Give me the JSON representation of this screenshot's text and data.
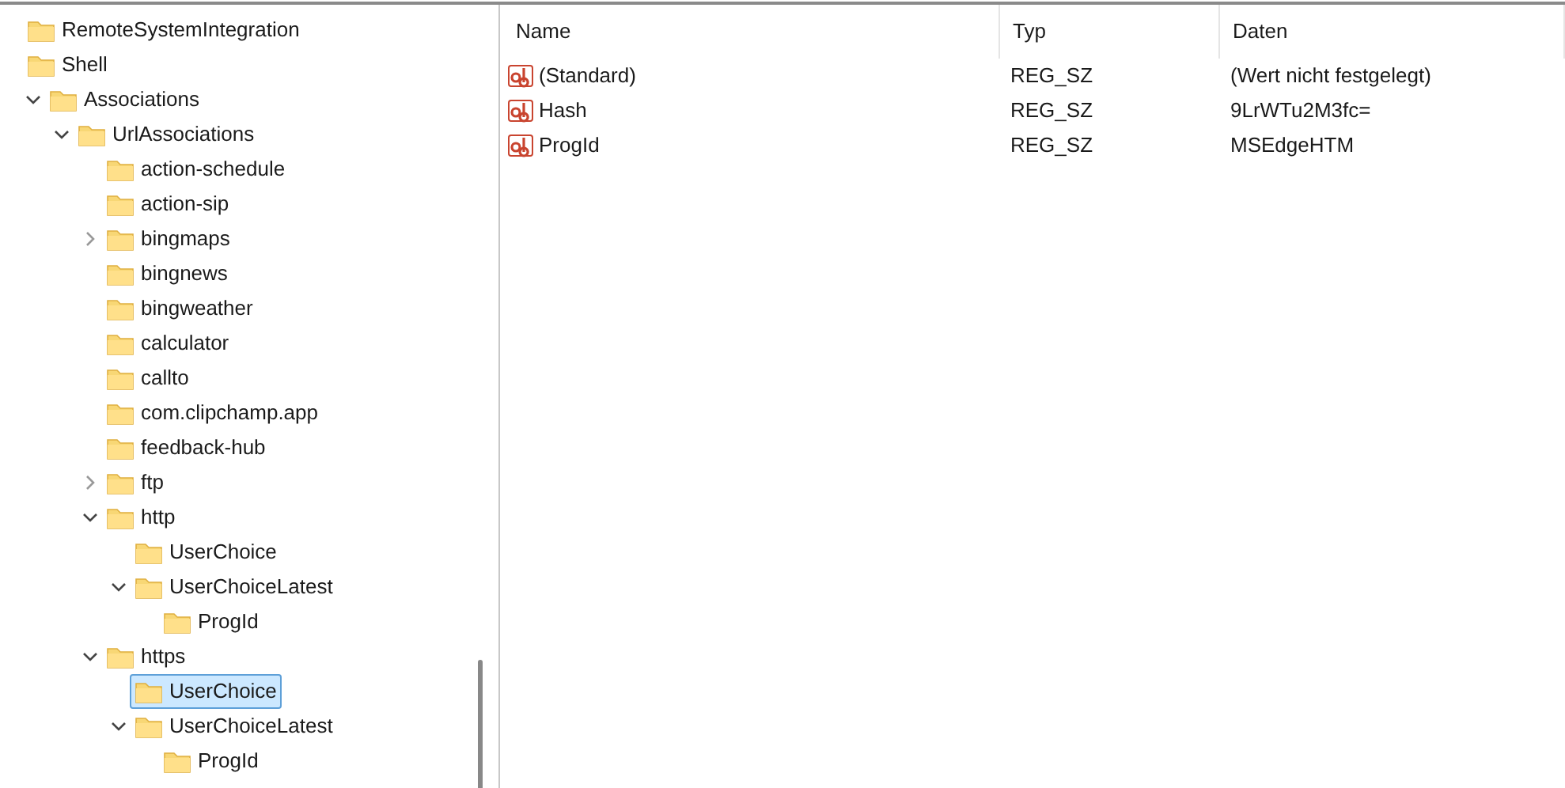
{
  "tree": [
    {
      "label": "RemoteSystemIntegration",
      "selected": false
    },
    {
      "label": "Shell",
      "selected": false,
      "children": [
        {
          "label": "Associations",
          "selected": false,
          "expanded": true,
          "children": [
            {
              "label": "UrlAssociations",
              "selected": false,
              "expanded": true,
              "children": [
                {
                  "label": "action-schedule",
                  "selected": false
                },
                {
                  "label": "action-sip",
                  "selected": false
                },
                {
                  "label": "bingmaps",
                  "selected": false,
                  "expanded": false
                },
                {
                  "label": "bingnews",
                  "selected": false
                },
                {
                  "label": "bingweather",
                  "selected": false
                },
                {
                  "label": "calculator",
                  "selected": false
                },
                {
                  "label": "callto",
                  "selected": false
                },
                {
                  "label": "com.clipchamp.app",
                  "selected": false
                },
                {
                  "label": "feedback-hub",
                  "selected": false
                },
                {
                  "label": "ftp",
                  "selected": false,
                  "expanded": false
                },
                {
                  "label": "http",
                  "selected": false,
                  "expanded": true,
                  "children": [
                    {
                      "label": "UserChoice",
                      "selected": false
                    },
                    {
                      "label": "UserChoiceLatest",
                      "selected": false,
                      "expanded": true,
                      "children": [
                        {
                          "label": "ProgId",
                          "selected": false
                        }
                      ]
                    }
                  ]
                },
                {
                  "label": "https",
                  "selected": false,
                  "expanded": true,
                  "children": [
                    {
                      "label": "UserChoice",
                      "selected": true
                    },
                    {
                      "label": "UserChoiceLatest",
                      "selected": false,
                      "expanded": true,
                      "children": [
                        {
                          "label": "ProgId",
                          "selected": false
                        }
                      ]
                    }
                  ]
                }
              ]
            }
          ]
        }
      ]
    }
  ],
  "values": {
    "columns": [
      "Name",
      "Typ",
      "Daten"
    ],
    "rows": [
      {
        "name": "(Standard)",
        "type": "REG_SZ",
        "data": "(Wert nicht festgelegt)"
      },
      {
        "name": "Hash",
        "type": "REG_SZ",
        "data": "9LrWTu2M3fc="
      },
      {
        "name": "ProgId",
        "type": "REG_SZ",
        "data": "MSEdgeHTM"
      }
    ]
  }
}
